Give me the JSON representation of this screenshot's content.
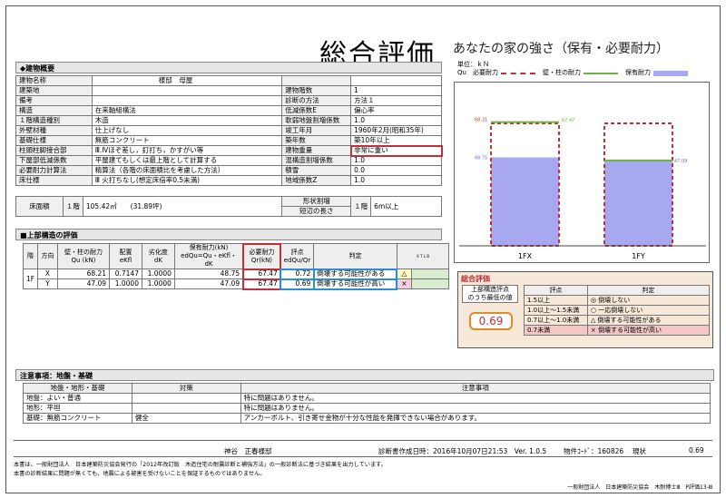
{
  "header": {
    "title": "総合評価",
    "subtitle": "あなたの家の強さ（保有・必要耐力）"
  },
  "building": {
    "section_label": "◆建物概要",
    "rows": [
      {
        "l1": "建物名称",
        "v1": "",
        "v1b": "様邸　母屋",
        "l2": "",
        "v2": ""
      },
      {
        "l1": "建築地",
        "v1": "",
        "l2": "建物階数",
        "v2": "1"
      },
      {
        "l1": "備考",
        "v1": "",
        "l2": "診断の方法",
        "v2": "方法１"
      },
      {
        "l1": "構造",
        "v1": "在来軸組構法",
        "l2": "低減係数E",
        "v2": "偏心率"
      },
      {
        "l1": "１階構造種別",
        "v1": "木造",
        "l2": "軟弱地盤割増係数",
        "v2": "1.0"
      },
      {
        "l1": "外壁材種",
        "v1": "仕上げなし",
        "l2": "竣工年月",
        "v2": "1960年2月(昭和35年)"
      },
      {
        "l1": "基礎仕様",
        "v1": "無筋コンクリート",
        "l2": "築年数",
        "v2": "築10年以上"
      },
      {
        "l1": "柱頭柱脚接合部",
        "v1": "Ⅲ.Ⅳほぞ差し，釘打ち，かすがい等",
        "l2": "建物重量",
        "v2": "非常に重い"
      },
      {
        "l1": "下屋部低減係数",
        "v1": "平屋建てもしくは最上階として計算する",
        "l2": "混構造割増係数",
        "v2": "1.0"
      },
      {
        "l1": "必要耐力計算法",
        "v1": "精算法（各階の床面積比を考慮した方法）",
        "l2": "積雪",
        "v2": "0.0"
      },
      {
        "l1": "床仕様",
        "v1": "Ⅲ 火打ちなし(想定床倍率0.5未満)",
        "l2": "地域係数Z",
        "v2": "1.0"
      }
    ],
    "floor_area_label": "床面積",
    "floor_label": "１階",
    "floor_area": "105.42㎡",
    "floor_tsubo": "(31.89坪)",
    "shape_label1": "形状割増",
    "shape_label2": "短辺の長さ",
    "shape_floor": "１階",
    "shape_value": "6m以上"
  },
  "upper": {
    "section_label": "■上部構造の評価",
    "headers": [
      "階",
      "方向",
      "壁・柱の耐力\nQu (kN)",
      "配置\neKfl",
      "劣化度\ndK",
      "保有耐力(kN)\nedQu=Qu・eKfl・dK",
      "必要耐力\nQr(kN)",
      "評点\nedQu/Qr",
      "判定"
    ],
    "floor": "1F",
    "rows": [
      {
        "dir": "X",
        "qu": "68.21",
        "ekfl": "0.7147",
        "dk": "1.0000",
        "edqu": "48.75",
        "qr": "67.47",
        "score": "0.72",
        "judge": "倒壊する可能性がある",
        "mark": "△"
      },
      {
        "dir": "Y",
        "qu": "47.09",
        "ekfl": "1.0000",
        "dk": "1.0000",
        "edqu": "47.09",
        "qr": "67.47",
        "score": "0.69",
        "judge": "倒壊する可能性が高い",
        "mark": "×"
      }
    ],
    "small_hdr": "X T L B"
  },
  "chart_data": {
    "type": "bar",
    "unit_label": "単位：ｋＮ",
    "legend": [
      {
        "name": "Qu　必要耐力",
        "color": "#c0303a"
      },
      {
        "name": "壁・柱の耐力",
        "color": "#6db33f"
      },
      {
        "name": "保有耐力",
        "color": "#a8a8f0"
      }
    ],
    "categories": [
      "1FX",
      "1FY"
    ],
    "series": [
      {
        "name": "必要耐力",
        "values": [
          67.47,
          67.47
        ]
      },
      {
        "name": "壁・柱の耐力",
        "values": [
          68.21,
          47.09
        ]
      },
      {
        "name": "保有耐力",
        "values": [
          48.75,
          47.09
        ]
      }
    ],
    "labels": {
      "qu_x": "68.21",
      "qr": "67.47",
      "edqu_x": "48.75",
      "edqu_y": "47.09"
    },
    "ylim": [
      0,
      80
    ]
  },
  "summary": {
    "label": "総合評価",
    "box_label1": "上部構造評点",
    "box_label2": "のうち最低の値",
    "value": "0.69",
    "col_score": "評点",
    "col_judge": "判定",
    "rows": [
      {
        "score": "1.5以上",
        "judge": "◎ 倒壊しない"
      },
      {
        "score": "1.0以上～1.5未満",
        "judge": "○ 一応倒壊しない"
      },
      {
        "score": "0.7以上～1.0未満",
        "judge": "△ 倒壊する可能性がある"
      },
      {
        "score": "0.7未満",
        "judge": "× 倒壊する可能性が高い"
      }
    ]
  },
  "notes": {
    "section_label": "注意事項：地盤・基礎",
    "headers": [
      "地盤・地形・基礎",
      "対策",
      "注意事項"
    ],
    "rows": [
      {
        "a": "地盤：よい・普通",
        "b": "",
        "c": "特に問題はありません。"
      },
      {
        "a": "地形：平坦",
        "b": "",
        "c": "特に問題はありません。"
      },
      {
        "a": "基礎：無筋コンクリート",
        "b": "健全",
        "c": "アンカーボルト、引き寄せ金物が十分な性能を発揮できない場合があります。"
      }
    ]
  },
  "footer": {
    "owner": "神谷　正春様邸",
    "date": "診断書作成日時：2016年10月07日21:53　Ver. 1.0.5",
    "code": "物件ｺｰﾄﾞ：160826",
    "status": "現状",
    "score": "0.69",
    "note1": "本書は、一般財団法人　日本建築防災協会発行の「2012年改訂版　木造住宅の耐震診断と補強方法」の一般診断法に基づき結果を出力しています。",
    "note2": "本書の診断結果に問題が無くても、地震による被害を受けないことを保証するものではありません。",
    "org": "一般財団法人　日本建築防災協会　木耐博士Ⅲ　P評価13-Ⅲ"
  }
}
